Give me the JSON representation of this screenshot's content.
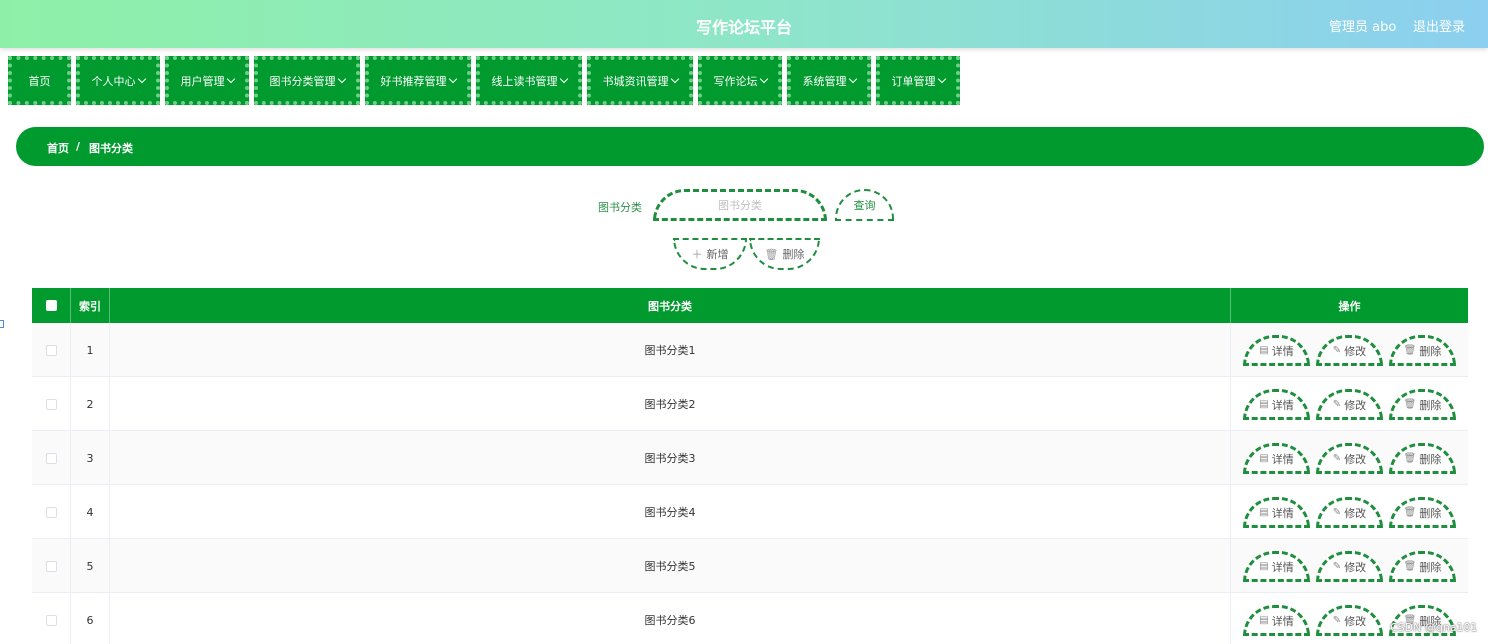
{
  "header": {
    "title": "写作论坛平台",
    "admin_label": "管理员 abo",
    "logout_label": "退出登录"
  },
  "nav": {
    "items": [
      {
        "label": "首页",
        "has_dropdown": false
      },
      {
        "label": "个人中心",
        "has_dropdown": true
      },
      {
        "label": "用户管理",
        "has_dropdown": true
      },
      {
        "label": "图书分类管理",
        "has_dropdown": true
      },
      {
        "label": "好书推荐管理",
        "has_dropdown": true
      },
      {
        "label": "线上读书管理",
        "has_dropdown": true
      },
      {
        "label": "书城资讯管理",
        "has_dropdown": true
      },
      {
        "label": "写作论坛",
        "has_dropdown": true
      },
      {
        "label": "系统管理",
        "has_dropdown": true
      },
      {
        "label": "订单管理",
        "has_dropdown": true
      }
    ]
  },
  "breadcrumb": {
    "home": "首页",
    "separator": "/",
    "current": "图书分类"
  },
  "search": {
    "label": "图书分类",
    "placeholder": "图书分类",
    "query_label": "查询",
    "add_label": "新增",
    "delete_label": "删除"
  },
  "table": {
    "columns": {
      "index": "索引",
      "category": "图书分类",
      "actions": "操作"
    },
    "rows": [
      {
        "index": "1",
        "category": "图书分类1"
      },
      {
        "index": "2",
        "category": "图书分类2"
      },
      {
        "index": "3",
        "category": "图书分类3"
      },
      {
        "index": "4",
        "category": "图书分类4"
      },
      {
        "index": "5",
        "category": "图书分类5"
      },
      {
        "index": "6",
        "category": "图书分类6"
      }
    ],
    "row_actions": {
      "detail": "详情",
      "edit": "修改",
      "delete": "删除"
    }
  },
  "watermark": "CSDN @qna101",
  "colors": {
    "primary": "#009a2e",
    "accent_border": "#1f8f3f",
    "nav_dots": "#6fd08a"
  }
}
